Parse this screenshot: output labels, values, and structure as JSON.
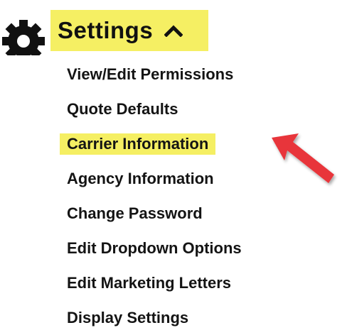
{
  "header": {
    "icon": "gear-icon",
    "title": "Settings",
    "toggle_icon": "chevron-up-icon",
    "highlight_color": "#f5ef63"
  },
  "menu": {
    "items": [
      {
        "label": "View/Edit Permissions",
        "highlighted": false
      },
      {
        "label": "Quote Defaults",
        "highlighted": false
      },
      {
        "label": "Carrier Information",
        "highlighted": true
      },
      {
        "label": "Agency Information",
        "highlighted": false
      },
      {
        "label": "Change Password",
        "highlighted": false
      },
      {
        "label": "Edit Dropdown Options",
        "highlighted": false
      },
      {
        "label": "Edit Marketing Letters",
        "highlighted": false
      },
      {
        "label": "Display Settings",
        "highlighted": false
      }
    ]
  },
  "annotation": {
    "icon": "arrow-pointer-icon",
    "color": "#e8363a"
  }
}
